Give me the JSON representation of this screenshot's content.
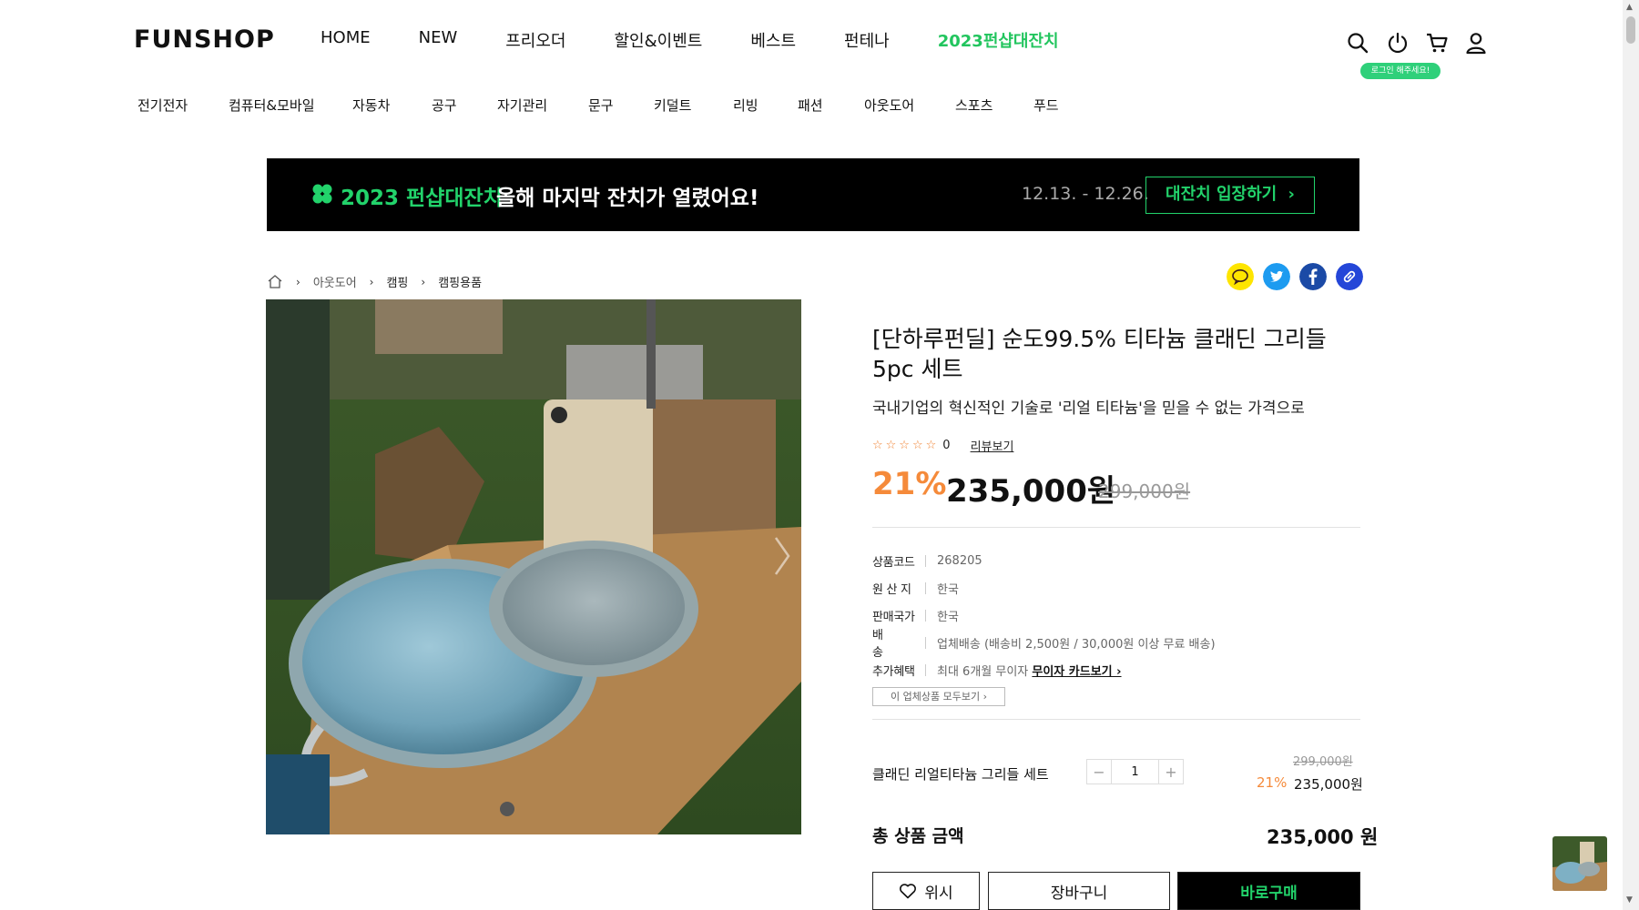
{
  "header": {
    "logo": "FUNSHOP",
    "gnb": [
      "HOME",
      "NEW",
      "프리오더",
      "할인&이벤트",
      "베스트",
      "펀테나",
      "2023펀샵대잔치"
    ],
    "login_badge": "로그인 해주세요!",
    "icons": [
      "search-icon",
      "power-icon",
      "cart-icon",
      "user-icon"
    ]
  },
  "categories": [
    "전기전자",
    "컴퓨터&모바일",
    "자동차",
    "공구",
    "자기관리",
    "문구",
    "키덜트",
    "리빙",
    "패션",
    "아웃도어",
    "스포츠",
    "푸드"
  ],
  "banner": {
    "event": "2023 펀샵대잔치",
    "message": "올해 마지막 잔치가 열렸어요!",
    "date": "12.13. - 12.26.",
    "button": "대잔치 입장하기"
  },
  "breadcrumb": [
    "아웃도어",
    "캠핑",
    "캠핑용품"
  ],
  "share_icons": [
    "kakaotalk-icon",
    "twitter-icon",
    "facebook-icon",
    "link-icon"
  ],
  "product": {
    "title": "[단하루펀딜] 순도99.5% 티타늄 클래딘 그리들 5pc 세트",
    "subtitle": "국내기업의 혁신적인 기술로 '리얼 티타늄'을 믿을 수 없는 가격으로",
    "stars": "☆☆☆☆☆",
    "rating": 0,
    "review_count": "0",
    "review_link": "리뷰보기",
    "discount_rate": "21%",
    "price": "235,000원",
    "original_price": "299,000원",
    "specs": [
      {
        "key": "상품코드",
        "value": "268205"
      },
      {
        "key": "원 산 지",
        "value": "한국"
      },
      {
        "key": "판매국가",
        "value": "한국"
      },
      {
        "key": "배　　송",
        "value": "업체배송 (배송비 2,500원 / 30,000원 이상 무료 배송)"
      },
      {
        "key": "추가혜택",
        "value": "최대 6개월 무이자 ",
        "link": "무이자 카드보기 ›"
      }
    ],
    "all_products_button": "이 업체상품 모두보기 ›"
  },
  "option": {
    "name": "클래딘 리얼티타늄 그리들 세트",
    "quantity": "1",
    "original_price": "299,000원",
    "discount_rate": "21%",
    "price": "235,000원"
  },
  "total": {
    "label": "총 상품 금액",
    "value": "235,000 원"
  },
  "buttons": {
    "wish": "위시",
    "cart": "장바구니",
    "buy": "바로구매"
  },
  "colors": {
    "accent_green": "#22d36b",
    "discount_orange": "#f58a3a",
    "banner_bg": "#000000"
  }
}
